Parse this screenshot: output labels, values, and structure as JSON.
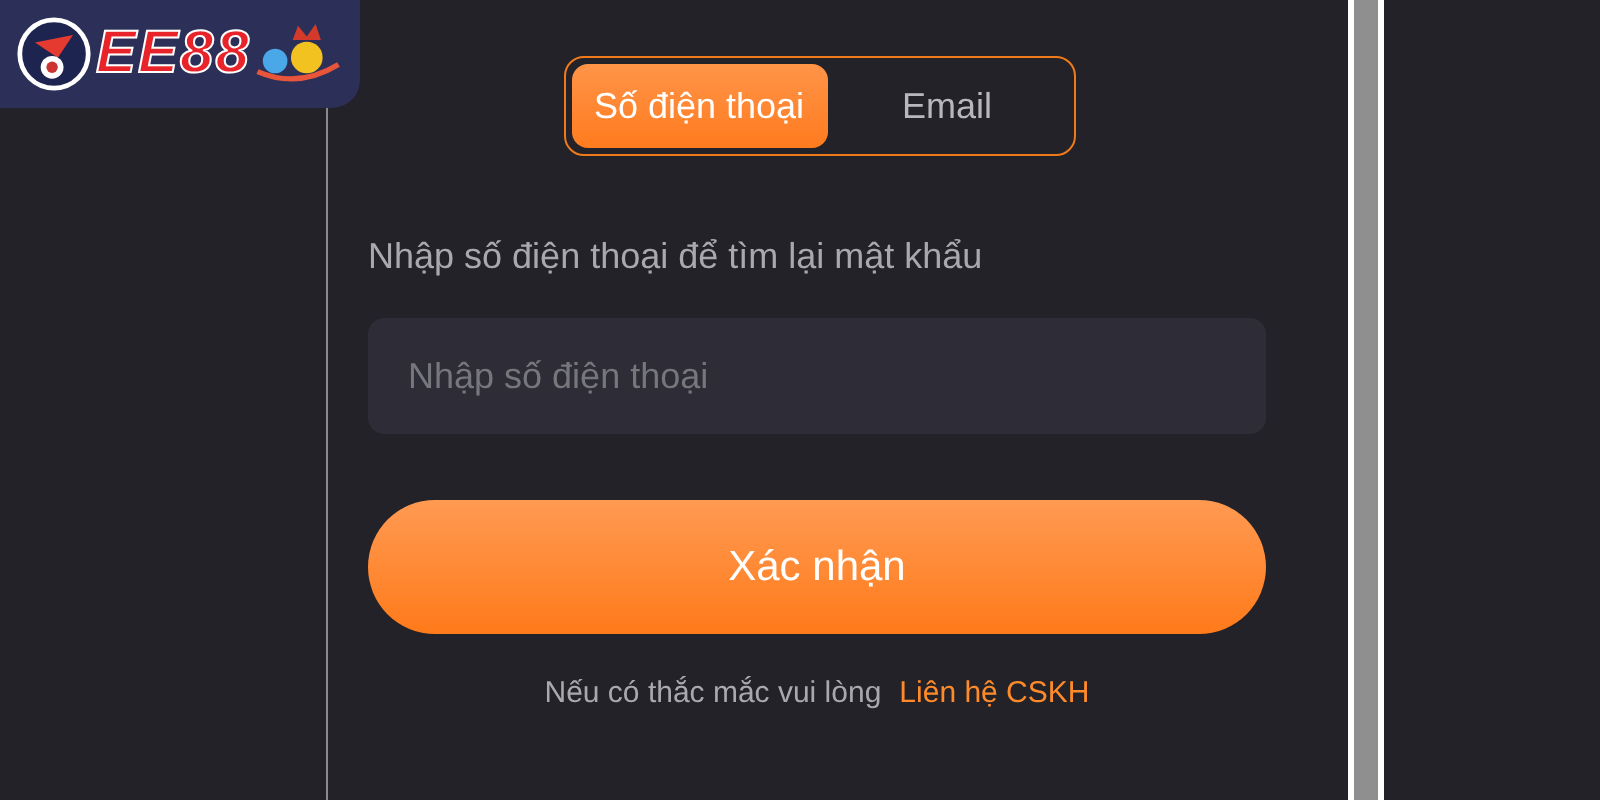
{
  "logo": {
    "text": "EE88"
  },
  "tabs": [
    {
      "label": "Số điện thoại",
      "selected": true
    },
    {
      "label": "Email",
      "selected": false
    }
  ],
  "prompt": "Nhập số điện thoại để tìm lại mật khẩu",
  "phone_field": {
    "placeholder": "Nhập số điện thoại"
  },
  "confirm_button": "Xác nhận",
  "help": {
    "text": "Nếu có thắc mắc vui lòng",
    "link": "Liên hệ CSKH"
  }
}
